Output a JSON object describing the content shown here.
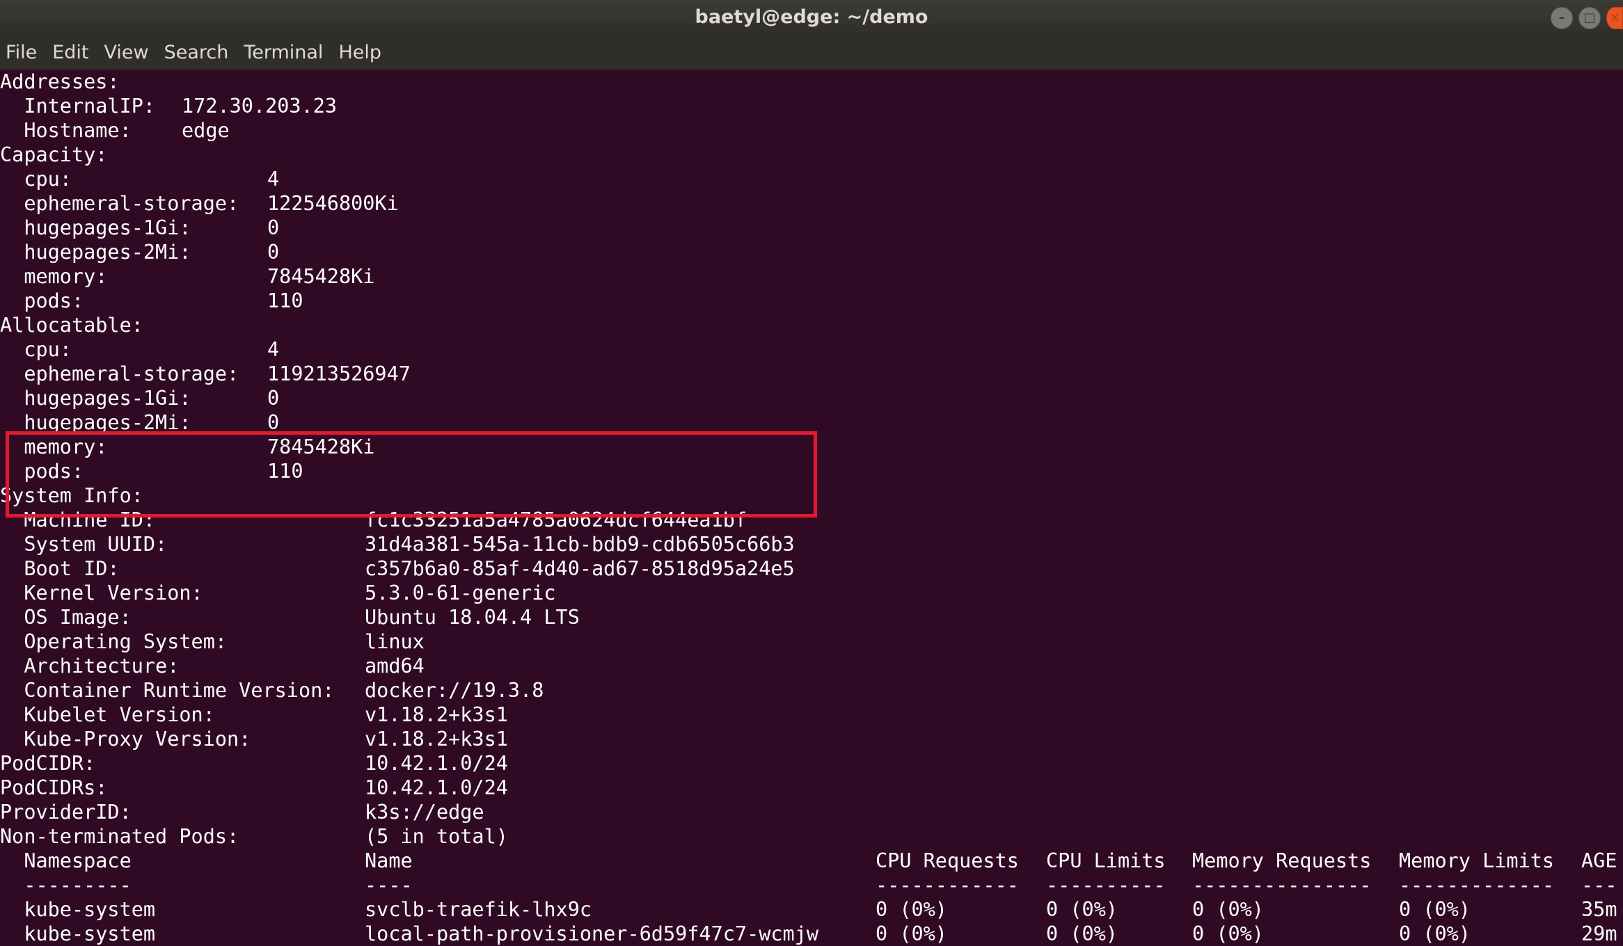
{
  "window": {
    "title": "baetyl@edge: ~/demo",
    "controls": {
      "minimize": "–",
      "maximize": "□",
      "close": "×"
    }
  },
  "menu": [
    "File",
    "Edit",
    "View",
    "Search",
    "Terminal",
    "Help"
  ],
  "terminal": {
    "addresses": {
      "header": "Addresses:",
      "rows": [
        {
          "key": "  InternalIP:",
          "value": "172.30.203.23"
        },
        {
          "key": "  Hostname:",
          "value": "edge"
        }
      ]
    },
    "capacity": {
      "header": "Capacity:",
      "rows": [
        {
          "key": "  cpu:",
          "value": "4"
        },
        {
          "key": "  ephemeral-storage:",
          "value": "122546800Ki"
        },
        {
          "key": "  hugepages-1Gi:",
          "value": "0"
        },
        {
          "key": "  hugepages-2Mi:",
          "value": "0"
        },
        {
          "key": "  memory:",
          "value": "7845428Ki"
        },
        {
          "key": "  pods:",
          "value": "110"
        }
      ]
    },
    "allocatable": {
      "header": "Allocatable:",
      "rows": [
        {
          "key": "  cpu:",
          "value": "4"
        },
        {
          "key": "  ephemeral-storage:",
          "value": "119213526947"
        },
        {
          "key": "  hugepages-1Gi:",
          "value": "0"
        },
        {
          "key": "  hugepages-2Mi:",
          "value": "0"
        },
        {
          "key": "  memory:",
          "value": "7845428Ki"
        },
        {
          "key": "  pods:",
          "value": "110"
        }
      ]
    },
    "system_info": {
      "header": "System Info:",
      "rows": [
        {
          "key": "  Machine ID:",
          "value": "fc1c33251a5a4785a0624dcf644ea1bf"
        },
        {
          "key": "  System UUID:",
          "value": "31d4a381-545a-11cb-bdb9-cdb6505c66b3"
        },
        {
          "key": "  Boot ID:",
          "value": "c357b6a0-85af-4d40-ad67-8518d95a24e5"
        },
        {
          "key": "  Kernel Version:",
          "value": "5.3.0-61-generic"
        },
        {
          "key": "  OS Image:",
          "value": "Ubuntu 18.04.4 LTS"
        },
        {
          "key": "  Operating System:",
          "value": "linux"
        },
        {
          "key": "  Architecture:",
          "value": "amd64"
        },
        {
          "key": "  Container Runtime Version:",
          "value": "docker://19.3.8"
        },
        {
          "key": "  Kubelet Version:",
          "value": "v1.18.2+k3s1"
        },
        {
          "key": "  Kube-Proxy Version:",
          "value": "v1.18.2+k3s1"
        }
      ]
    },
    "pod_cidr": {
      "key": "PodCIDR:",
      "value": "10.42.1.0/24"
    },
    "pod_cidrs": {
      "key": "PodCIDRs:",
      "value": "10.42.1.0/24"
    },
    "provider_id": {
      "key": "ProviderID:",
      "value": "k3s://edge"
    },
    "non_terminated": {
      "key": "Non-terminated Pods:",
      "value": "(5 in total)"
    },
    "pods_table": {
      "headers": [
        "  Namespace",
        "Name",
        "CPU Requests",
        "CPU Limits",
        "Memory Requests",
        "Memory Limits",
        "AGE"
      ],
      "separators": [
        "  ---------",
        "----",
        "------------",
        "----------",
        "---------------",
        "-------------",
        "---"
      ],
      "rows": [
        [
          "  kube-system",
          "svclb-traefik-lhx9c",
          "0 (0%)",
          "0 (0%)",
          "0 (0%)",
          "0 (0%)",
          "35m"
        ],
        [
          "  kube-system",
          "local-path-provisioner-6d59f47c7-wcmjw",
          "0 (0%)",
          "0 (0%)",
          "0 (0%)",
          "0 (0%)",
          "29m"
        ]
      ]
    }
  }
}
